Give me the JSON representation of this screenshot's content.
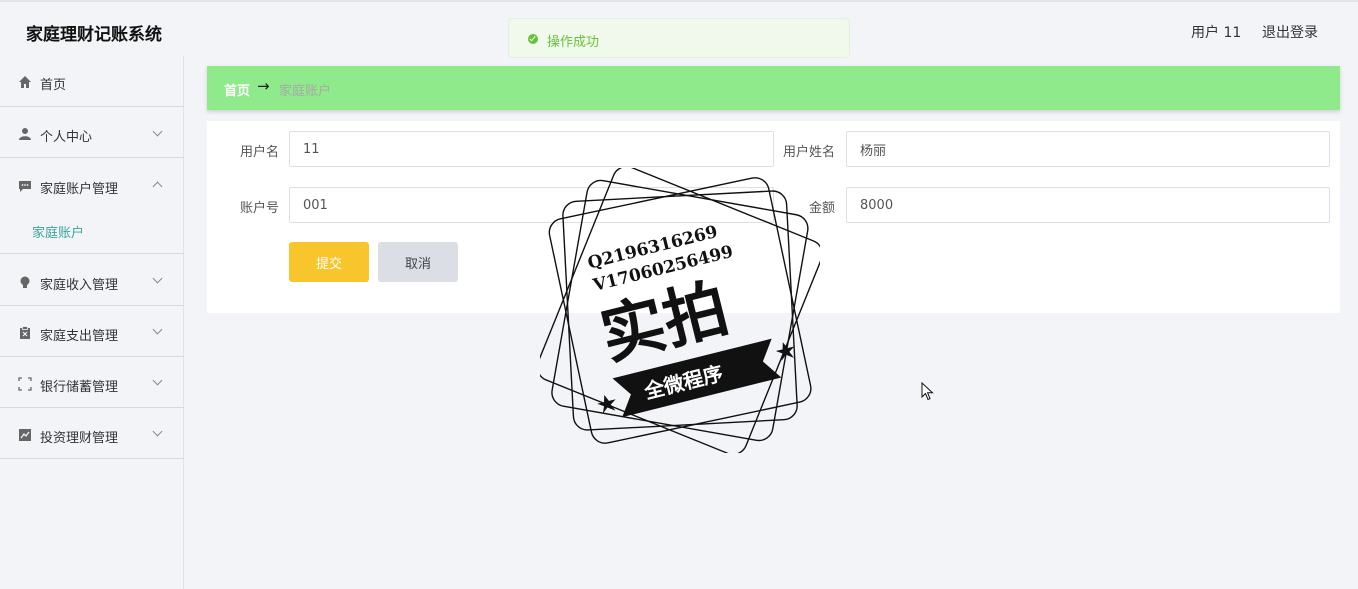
{
  "app": {
    "title": "家庭理财记账系统"
  },
  "header": {
    "user_label": "用户 11",
    "logout_label": "退出登录"
  },
  "toast": {
    "message": "操作成功",
    "color": "#67c23a"
  },
  "sidebar": {
    "items": [
      {
        "label": "首页",
        "icon": "home-icon"
      },
      {
        "label": "个人中心",
        "icon": "user-icon"
      },
      {
        "label": "家庭账户管理",
        "icon": "chat-icon",
        "sub_items": [
          {
            "label": "家庭账户"
          }
        ]
      },
      {
        "label": "家庭收入管理",
        "icon": "bulb-icon"
      },
      {
        "label": "家庭支出管理",
        "icon": "clipboard-icon"
      },
      {
        "label": "银行储蓄管理",
        "icon": "fullscreen-icon"
      },
      {
        "label": "投资理财管理",
        "icon": "chart-icon"
      }
    ]
  },
  "breadcrumb": {
    "home": "首页",
    "separator": "→",
    "current": "家庭账户",
    "bg": "#8fea8c"
  },
  "form": {
    "username_label": "用户名",
    "username_value": "11",
    "realname_label": "用户姓名",
    "realname_value": "杨丽",
    "account_label": "账户号",
    "account_value": "001",
    "amount_label": "金额",
    "amount_value": "8000",
    "submit_label": "提交",
    "cancel_label": "取消"
  },
  "watermark": {
    "line1": "Q2196316269",
    "line2": "V17060256499",
    "main": "实拍",
    "banner": "全微程序"
  },
  "colors": {
    "accent": "#3aa5a0",
    "submit": "#f8c52d",
    "cancel": "#dcdee6"
  }
}
